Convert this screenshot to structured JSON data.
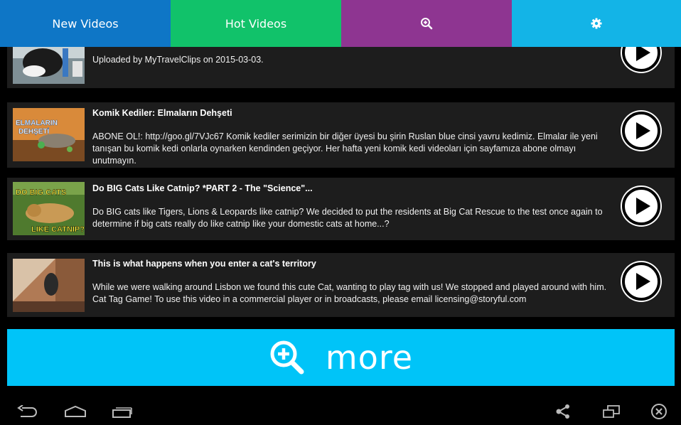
{
  "tabs": [
    {
      "label": "New Videos",
      "color": "#0e76c6"
    },
    {
      "label": "Hot Videos",
      "color": "#11c26a"
    },
    {
      "icon": "search-plus-icon",
      "color": "#8e3591"
    },
    {
      "icon": "gear-icon",
      "color": "#13b4e7"
    }
  ],
  "videos": [
    {
      "title": "",
      "description": "Uploaded by MyTravelClips on 2015-03-03."
    },
    {
      "title": "Komik Kediler: Elmaların Dehşeti",
      "description": "ABONE OL!: http://goo.gl/7VJc67 Komik kediler serimizin bir diğer üyesi bu şirin Ruslan blue cinsi yavru kedimiz. Elmalar ile yeni tanışan bu komik kedi onlarla oynarken kendinden geçiyor. Her hafta yeni komik kedi videoları için sayfamıza abone olmayı unutmayın.",
      "thumb_text": [
        "ELMALARIN",
        "DEHŞETİ"
      ]
    },
    {
      "title": "Do BIG Cats Like Catnip? *PART 2 - The \"Science\"...",
      "description": "Do BIG cats like Tigers, Lions & Leopards like catnip? We decided to put the residents at Big Cat Rescue to the test once again to determine if big cats really do like catnip like your domestic cats at home...?",
      "thumb_text": [
        "DO BIG CATS",
        "LIKE CATNIP?"
      ]
    },
    {
      "title": "This is what happens when you enter a cat's territory",
      "description": "While we were walking around Lisbon we found this cute Cat, wanting to play tag with us! We stopped and played around with him. Cat Tag Game! To use this video in a commercial player or in broadcasts, please email licensing@storyful.com"
    }
  ],
  "more_button": {
    "label": "more",
    "icon": "search-plus-icon",
    "color": "#00c4f8"
  },
  "system_nav": {
    "left": [
      "back-icon",
      "home-icon",
      "recent-apps-icon"
    ],
    "right": [
      "share-icon",
      "screen-mirror-icon",
      "close-circle-icon"
    ]
  }
}
